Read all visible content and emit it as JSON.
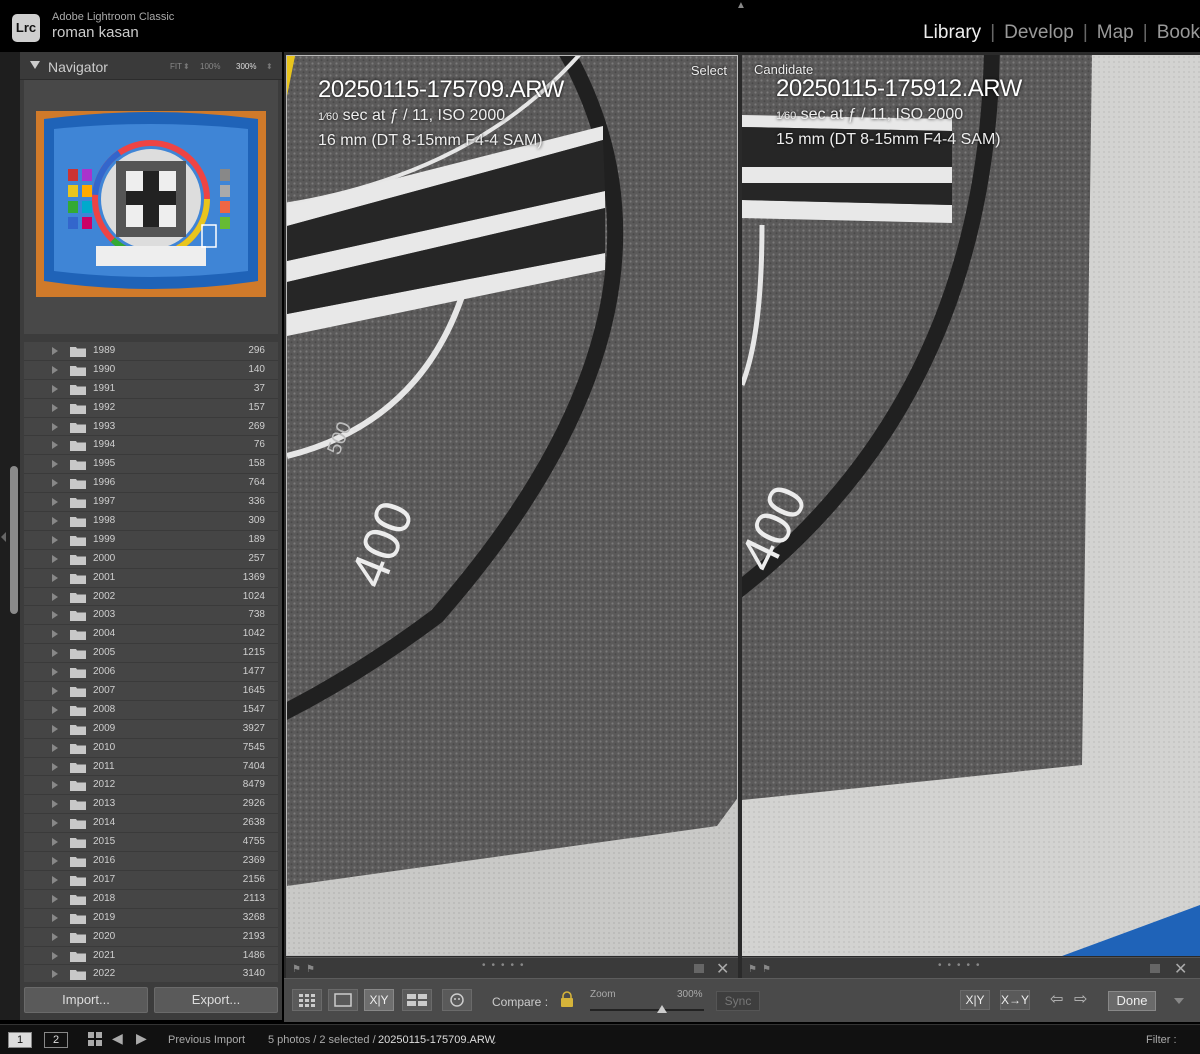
{
  "app": {
    "name": "Adobe Lightroom Classic",
    "logo": "Lrc",
    "user": "roman kasan"
  },
  "modules": [
    {
      "label": "Library",
      "active": true
    },
    {
      "label": "Develop",
      "active": false
    },
    {
      "label": "Map",
      "active": false
    },
    {
      "label": "Book",
      "active": false
    }
  ],
  "navigator": {
    "title": "Navigator",
    "zoom_options": [
      "FIT",
      "100%",
      "300%"
    ],
    "active_zoom": "300%"
  },
  "folders": [
    {
      "name": "1989",
      "count": "296"
    },
    {
      "name": "1990",
      "count": "140"
    },
    {
      "name": "1991",
      "count": "37"
    },
    {
      "name": "1992",
      "count": "157"
    },
    {
      "name": "1993",
      "count": "269"
    },
    {
      "name": "1994",
      "count": "76"
    },
    {
      "name": "1995",
      "count": "158"
    },
    {
      "name": "1996",
      "count": "764"
    },
    {
      "name": "1997",
      "count": "336"
    },
    {
      "name": "1998",
      "count": "309"
    },
    {
      "name": "1999",
      "count": "189"
    },
    {
      "name": "2000",
      "count": "257"
    },
    {
      "name": "2001",
      "count": "1369"
    },
    {
      "name": "2002",
      "count": "1024"
    },
    {
      "name": "2003",
      "count": "738"
    },
    {
      "name": "2004",
      "count": "1042"
    },
    {
      "name": "2005",
      "count": "1215"
    },
    {
      "name": "2006",
      "count": "1477"
    },
    {
      "name": "2007",
      "count": "1645"
    },
    {
      "name": "2008",
      "count": "1547"
    },
    {
      "name": "2009",
      "count": "3927"
    },
    {
      "name": "2010",
      "count": "7545"
    },
    {
      "name": "2011",
      "count": "7404"
    },
    {
      "name": "2012",
      "count": "8479"
    },
    {
      "name": "2013",
      "count": "2926"
    },
    {
      "name": "2014",
      "count": "2638"
    },
    {
      "name": "2015",
      "count": "4755"
    },
    {
      "name": "2016",
      "count": "2369"
    },
    {
      "name": "2017",
      "count": "2156"
    },
    {
      "name": "2018",
      "count": "2113"
    },
    {
      "name": "2019",
      "count": "3268"
    },
    {
      "name": "2020",
      "count": "2193"
    },
    {
      "name": "2021",
      "count": "1486"
    },
    {
      "name": "2022",
      "count": "3140"
    }
  ],
  "buttons": {
    "import": "Import...",
    "export": "Export..."
  },
  "select_photo": {
    "label": "Select",
    "filename": "20250115-175709.ARW",
    "shutter_fraction": "1⁄60",
    "exposure_rest": " sec at ƒ / 11, ISO 2000",
    "lens": "16 mm (DT 8-15mm F4-4 SAM)",
    "chart_number": "400"
  },
  "candidate_photo": {
    "label": "Candidate",
    "filename": "20250115-175912.ARW",
    "shutter_fraction": "1⁄60",
    "exposure_rest": " sec at ƒ / 11, ISO 2000",
    "lens": "15 mm (DT 8-15mm F4-4 SAM)",
    "chart_number": "400"
  },
  "toolbar": {
    "xy_label": "X|Y",
    "compare_label": "Compare :",
    "zoom_label": "Zoom",
    "zoom_value": "300%",
    "zoom_fraction": 0.63,
    "sync_label": "Sync",
    "swap_label": "X|Y",
    "make_select_label": "X→Y",
    "done_label": "Done"
  },
  "filmstrip": {
    "screen1": "1",
    "screen2": "2",
    "source": "Previous Import",
    "count_text": "5 photos / 2 selected /",
    "current_file": "20250115-175709.ARW",
    "filter_label": "Filter :"
  },
  "colors": {
    "panel_bg": "#3c3c3c",
    "folder_bg": "#454545",
    "chart_gray": "#5a5959",
    "target_blue": "#1f63b8",
    "target_orange": "#d07a2a"
  }
}
